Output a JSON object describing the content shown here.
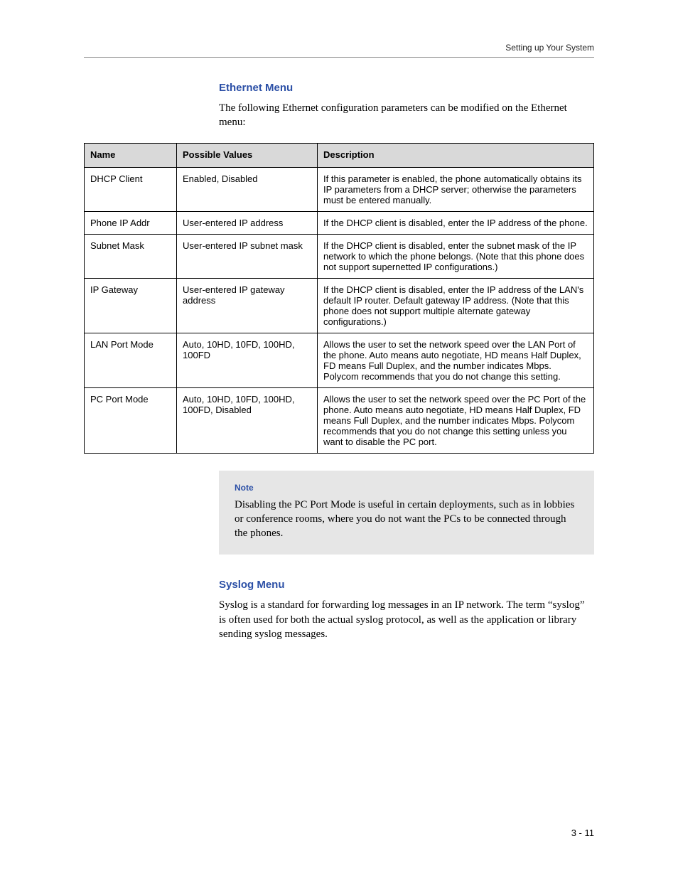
{
  "header": {
    "running_title": "Setting up Your System"
  },
  "sections": {
    "ethernet": {
      "heading": "Ethernet Menu",
      "intro": "The following Ethernet configuration parameters can be modified on the Ethernet menu:"
    },
    "syslog": {
      "heading": "Syslog Menu",
      "intro": "Syslog is a standard for forwarding log messages in an IP network. The term “syslog” is often used for both the actual syslog protocol, as well as the application or library sending syslog messages."
    }
  },
  "table": {
    "head": {
      "c1": "Name",
      "c2": "Possible Values",
      "c3": "Description"
    },
    "rows": [
      {
        "c1": "DHCP Client",
        "c2": "Enabled, Disabled",
        "c3": "If this parameter is enabled, the phone automatically obtains its IP parameters from a DHCP server; otherwise the parameters must be entered manually."
      },
      {
        "c1": "Phone IP Addr",
        "c2": "User-entered IP address",
        "c3": "If the DHCP client is disabled, enter the IP address of the phone."
      },
      {
        "c1": "Subnet Mask",
        "c2": "User-entered IP subnet mask",
        "c3": "If the DHCP client is disabled, enter the subnet mask of the IP network to which the phone belongs. (Note that this phone does not support supernetted IP configurations.)"
      },
      {
        "c1": "IP Gateway",
        "c2": "User-entered IP gateway address",
        "c3": "If the DHCP client is disabled, enter the IP address of the LAN's default IP router.\nDefault gateway IP address. (Note that this phone does not support multiple alternate gateway configurations.)"
      },
      {
        "c1": "LAN Port Mode",
        "c2": "Auto, 10HD, 10FD, 100HD, 100FD",
        "c3": "Allows the user to set the network speed over the LAN Port of the phone. Auto means auto negotiate, HD means Half Duplex, FD means Full Duplex, and the number indicates Mbps. Polycom recommends that you do not change this setting."
      },
      {
        "c1": "PC Port Mode",
        "c2": "Auto, 10HD, 10FD, 100HD, 100FD, Disabled",
        "c3": "Allows the user to set the network speed over the PC Port of the phone. Auto means auto negotiate, HD means Half Duplex, FD means Full Duplex, and the number indicates Mbps. Polycom recommends that you do not change this setting unless you want to disable the PC port."
      }
    ]
  },
  "note": {
    "label": "Note",
    "text": "Disabling the PC Port Mode is useful in certain deployments, such as in lobbies or conference rooms, where you do not want the PCs to be connected through the phones."
  },
  "footer": {
    "page_number": "3 - 11"
  }
}
